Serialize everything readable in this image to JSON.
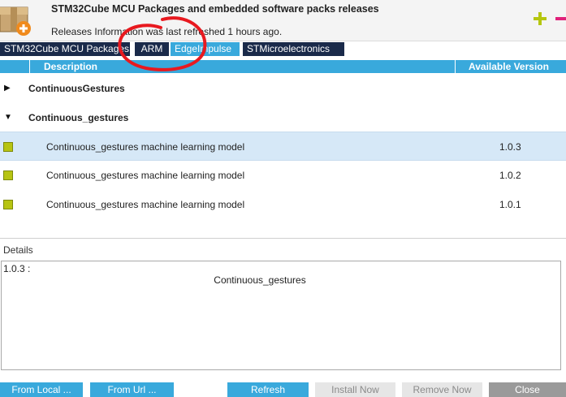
{
  "header": {
    "title": "STM32Cube MCU Packages and embedded software packs releases",
    "subtitle": "Releases Information was last refreshed 1 hours ago.",
    "icons": {
      "package": "package-add-icon",
      "add": "plus-icon",
      "remove": "minus-icon"
    },
    "colors": {
      "add": "#b5c60f",
      "remove": "#e0207a"
    }
  },
  "tabs": [
    {
      "label": "STM32Cube MCU Packages",
      "active": false
    },
    {
      "label": "ARM",
      "active": false
    },
    {
      "label": "EdgeImpulse",
      "active": true
    },
    {
      "label": "STMicroelectronics",
      "active": false
    }
  ],
  "list": {
    "columns": {
      "description": "Description",
      "version": "Available Version"
    },
    "groups": [
      {
        "name": "ContinuousGestures",
        "expanded": false,
        "items": []
      },
      {
        "name": "Continuous_gestures",
        "expanded": true,
        "items": [
          {
            "label": "Continuous_gestures machine learning model",
            "version": "1.0.3",
            "selected": true
          },
          {
            "label": "Continuous_gestures machine learning model",
            "version": "1.0.2",
            "selected": false
          },
          {
            "label": "Continuous_gestures machine learning model",
            "version": "1.0.1",
            "selected": false
          }
        ]
      }
    ]
  },
  "details": {
    "label": "Details",
    "version_line": "1.0.3 :",
    "name": "Continuous_gestures"
  },
  "buttons": {
    "from_local": "From Local ...",
    "from_url": "From Url ...",
    "refresh": "Refresh",
    "install": "Install Now",
    "remove": "Remove Now",
    "close": "Close"
  },
  "colors": {
    "accent": "#39a9dc",
    "tab_dark": "#1a2a4a",
    "selected_row": "#d6e8f7",
    "item_status": "#b7c412",
    "annotation": "#e8191f"
  }
}
